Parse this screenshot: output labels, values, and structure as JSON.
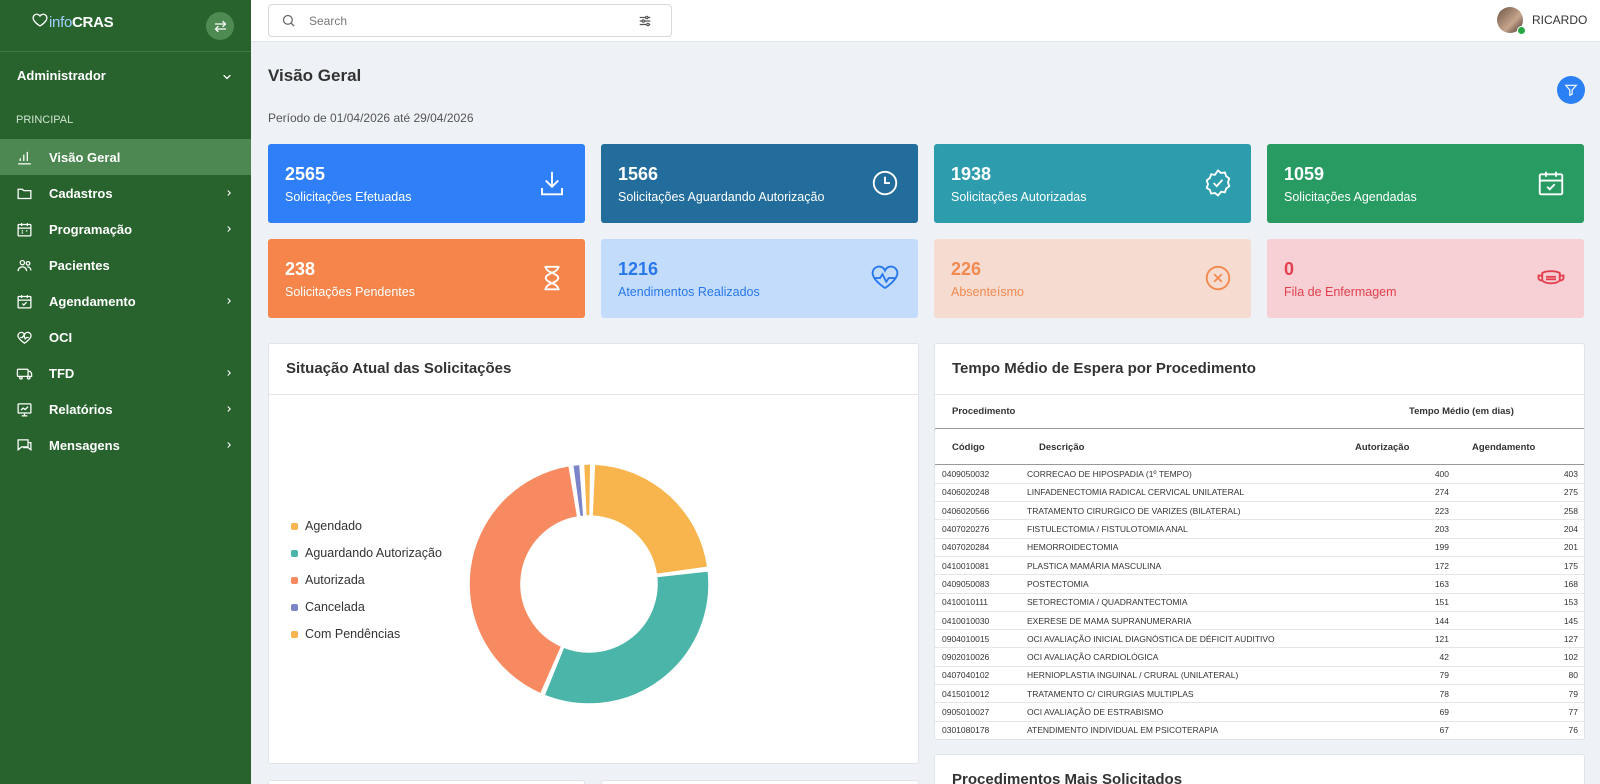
{
  "app": {
    "logo_info": "info",
    "logo_cras": "CRAS"
  },
  "sidebar": {
    "user_role": "Administrador",
    "section": "PRINCIPAL",
    "items": [
      {
        "label": "Visão Geral",
        "icon": "bar-chart-icon",
        "active": true
      },
      {
        "label": "Cadastros",
        "icon": "folder-icon",
        "chevron": true
      },
      {
        "label": "Programação",
        "icon": "calendar-grid-icon",
        "chevron": true
      },
      {
        "label": "Pacientes",
        "icon": "users-icon"
      },
      {
        "label": "Agendamento",
        "icon": "calendar-check-icon",
        "chevron": true
      },
      {
        "label": "OCI",
        "icon": "heart-pulse-icon"
      },
      {
        "label": "TFD",
        "icon": "bus-icon",
        "chevron": true
      },
      {
        "label": "Relatórios",
        "icon": "presentation-chart-icon",
        "chevron": true
      },
      {
        "label": "Mensagens",
        "icon": "chat-icon",
        "chevron": true
      }
    ]
  },
  "topbar": {
    "search_placeholder": "Search",
    "search_value": "",
    "user_name": "RICARDO"
  },
  "page": {
    "title": "Visão Geral",
    "period": "Período de 01/04/2026 até 29/04/2026"
  },
  "cards": [
    {
      "value": "2565",
      "label": "Solicitações Efetuadas",
      "icon": "download-icon",
      "bg": "#2f80f8",
      "fg": "#ffffff"
    },
    {
      "value": "1566",
      "label": "Solicitações Aguardando Autorização",
      "icon": "clock-icon",
      "bg": "#236d9c",
      "fg": "#ffffff"
    },
    {
      "value": "1938",
      "label": "Solicitações Autorizadas",
      "icon": "badge-check-icon",
      "bg": "#2d9dae",
      "fg": "#ffffff"
    },
    {
      "value": "1059",
      "label": "Solicitações Agendadas",
      "icon": "calendar-check-icon",
      "bg": "#279b62",
      "fg": "#ffffff"
    },
    {
      "value": "238",
      "label": "Solicitações Pendentes",
      "icon": "hourglass-icon",
      "bg": "#f5854a",
      "fg": "#ffffff"
    },
    {
      "value": "1216",
      "label": "Atendimentos Realizados",
      "icon": "heartbeat-icon",
      "bg": "#c3dcfc",
      "fg": "#2878ec"
    },
    {
      "value": "226",
      "label": "Absenteísmo",
      "icon": "x-circle-icon",
      "bg": "#f6dbd1",
      "fg": "#f28a4f"
    },
    {
      "value": "0",
      "label": "Fila de Enfermagem",
      "icon": "mask-icon",
      "bg": "#f6d0d4",
      "fg": "#e2404e"
    }
  ],
  "status_panel": {
    "title": "Situação Atual das Solicitações"
  },
  "chart_data": {
    "type": "pie",
    "donut": true,
    "categories": [
      "Agendado",
      "Aguardando Autorização",
      "Autorizada",
      "Cancelada",
      "Com Pendências"
    ],
    "values": [
      1059,
      1566,
      1938,
      68,
      68
    ],
    "colors": [
      "#f8b54d",
      "#4ab5a8",
      "#f78a60",
      "#7b85c8",
      "#f8b54d"
    ]
  },
  "wait_panel": {
    "title": "Tempo Médio de Espera por Procedimento",
    "group_headers": {
      "procedure": "Procedimento",
      "avg": "Tempo Médio (em dias)"
    },
    "columns": {
      "code": "Código",
      "desc": "Descrição",
      "auth": "Autorização",
      "sched": "Agendamento"
    },
    "rows": [
      {
        "code": "0409050032",
        "desc": "CORRECAO DE HIPOSPADIA (1º TEMPO)",
        "auth": "400",
        "sched": "403"
      },
      {
        "code": "0406020248",
        "desc": "LINFADENECTOMIA RADICAL CERVICAL UNILATERAL",
        "auth": "274",
        "sched": "275"
      },
      {
        "code": "0406020566",
        "desc": "TRATAMENTO CIRURGICO DE VARIZES (BILATERAL)",
        "auth": "223",
        "sched": "258"
      },
      {
        "code": "0407020276",
        "desc": "FISTULECTOMIA / FISTULOTOMIA ANAL",
        "auth": "203",
        "sched": "204"
      },
      {
        "code": "0407020284",
        "desc": "HEMORROIDECTOMIA",
        "auth": "199",
        "sched": "201"
      },
      {
        "code": "0410010081",
        "desc": "PLASTICA MAMÁRIA MASCULINA",
        "auth": "172",
        "sched": "175"
      },
      {
        "code": "0409050083",
        "desc": "POSTECTOMIA",
        "auth": "163",
        "sched": "168"
      },
      {
        "code": "0410010111",
        "desc": "SETORECTOMIA / QUADRANTECTOMIA",
        "auth": "151",
        "sched": "153"
      },
      {
        "code": "0410010030",
        "desc": "EXERESE DE MAMA SUPRANUMERARIA",
        "auth": "144",
        "sched": "145"
      },
      {
        "code": "0904010015",
        "desc": "OCI AVALIAÇÃO INICIAL DIAGNÓSTICA DE DÉFICIT AUDITIVO",
        "auth": "121",
        "sched": "127"
      },
      {
        "code": "0902010026",
        "desc": "OCI AVALIAÇÃO CARDIOLÓGICA",
        "auth": "42",
        "sched": "102"
      },
      {
        "code": "0407040102",
        "desc": "HERNIOPLASTIA INGUINAL / CRURAL (UNILATERAL)",
        "auth": "79",
        "sched": "80"
      },
      {
        "code": "0415010012",
        "desc": "TRATAMENTO C/ CIRURGIAS MULTIPLAS",
        "auth": "78",
        "sched": "79"
      },
      {
        "code": "0905010027",
        "desc": "OCI AVALIAÇÃO DE ESTRABISMO",
        "auth": "69",
        "sched": "77"
      },
      {
        "code": "0301080178",
        "desc": "ATENDIMENTO INDIVIDUAL EM PSICOTERAPIA",
        "auth": "67",
        "sched": "76"
      }
    ]
  },
  "most_requested": {
    "title": "Procedimentos Mais Solicitados"
  }
}
